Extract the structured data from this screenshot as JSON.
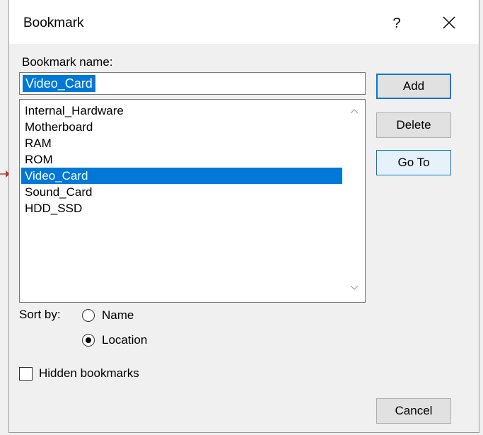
{
  "window": {
    "title": "Bookmark",
    "help_label": "?",
    "close_icon": "close-icon"
  },
  "form": {
    "name_label": "Bookmark name:",
    "name_value": "Video_Card"
  },
  "bookmarks": [
    {
      "label": "Internal_Hardware",
      "selected": false
    },
    {
      "label": "Motherboard",
      "selected": false
    },
    {
      "label": "RAM",
      "selected": false
    },
    {
      "label": "ROM",
      "selected": false
    },
    {
      "label": "Video_Card",
      "selected": true
    },
    {
      "label": "Sound_Card",
      "selected": false
    },
    {
      "label": "HDD_SSD",
      "selected": false
    }
  ],
  "buttons": {
    "add": "Add",
    "delete": "Delete",
    "goto": "Go To",
    "cancel": "Cancel"
  },
  "sort": {
    "label": "Sort by:",
    "options": [
      {
        "label": "Name",
        "checked": false
      },
      {
        "label": "Location",
        "checked": true
      }
    ]
  },
  "hidden_bookmarks": {
    "label": "Hidden bookmarks",
    "checked": false
  },
  "colors": {
    "selection": "#0078d7",
    "dialog_bg": "#f0f0f0",
    "annotation_arrow": "#c0392b"
  }
}
